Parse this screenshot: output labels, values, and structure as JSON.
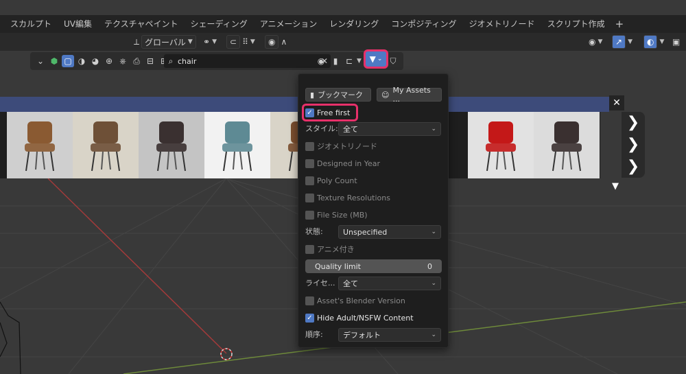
{
  "workspace_tabs": [
    "スカルプト",
    "UV編集",
    "テクスチャペイント",
    "シェーディング",
    "アニメーション",
    "レンダリング",
    "コンポジティング",
    "ジオメトリノード",
    "スクリプト作成"
  ],
  "add_tab": "+",
  "header": {
    "transform_orientation": "グローバル"
  },
  "search": {
    "value": "chair"
  },
  "panel": {
    "bookmark_label": "ブックマーク",
    "my_assets_label": "My Assets ...",
    "free_first": {
      "label": "Free first",
      "checked": true
    },
    "style_label": "スタイル:",
    "style_value": "全て",
    "checks": [
      {
        "label": "ジオメトリノード",
        "checked": false
      },
      {
        "label": "Designed in Year",
        "checked": false
      },
      {
        "label": "Poly Count",
        "checked": false
      },
      {
        "label": "Texture Resolutions",
        "checked": false
      },
      {
        "label": "File Size (MB)",
        "checked": false
      }
    ],
    "state_label": "状態:",
    "state_value": "Unspecified",
    "animated": {
      "label": "アニメ付き",
      "checked": false
    },
    "quality_label": "Quality limit",
    "quality_value": "0",
    "license_label": "ライセ...",
    "license_value": "全て",
    "blender_version": {
      "label": "Asset's Blender Version",
      "checked": false
    },
    "hide_adult": {
      "label": "Hide Adult/NSFW Content",
      "checked": true
    },
    "order_label": "順序:",
    "order_value": "デフォルト"
  },
  "thumbnails": [
    {
      "name": "wood-metal-chair",
      "bg": "#cfcfcf",
      "color": "#8a5a32"
    },
    {
      "name": "wood-lounge-chair",
      "bg": "#d9d4c8",
      "color": "#6e5037"
    },
    {
      "name": "zebra-armchair",
      "bg": "#c4c4c4",
      "color": "#3a3030"
    },
    {
      "name": "teal-office-chair",
      "bg": "#f2f2f2",
      "color": "#5e8a94"
    },
    {
      "name": "wood-chair-2",
      "bg": "#d9d4c8",
      "color": "#7a4e2e"
    },
    {
      "name": "red-wire-chair",
      "bg": "#e2e2e2",
      "color": "#c41818"
    },
    {
      "name": "zebra-wire-chair",
      "bg": "#dcdcdc",
      "color": "#3a3030"
    }
  ],
  "colors": {
    "accent": "#4f79c4",
    "highlight": "#e8306a",
    "band": "#3d4b7a"
  }
}
